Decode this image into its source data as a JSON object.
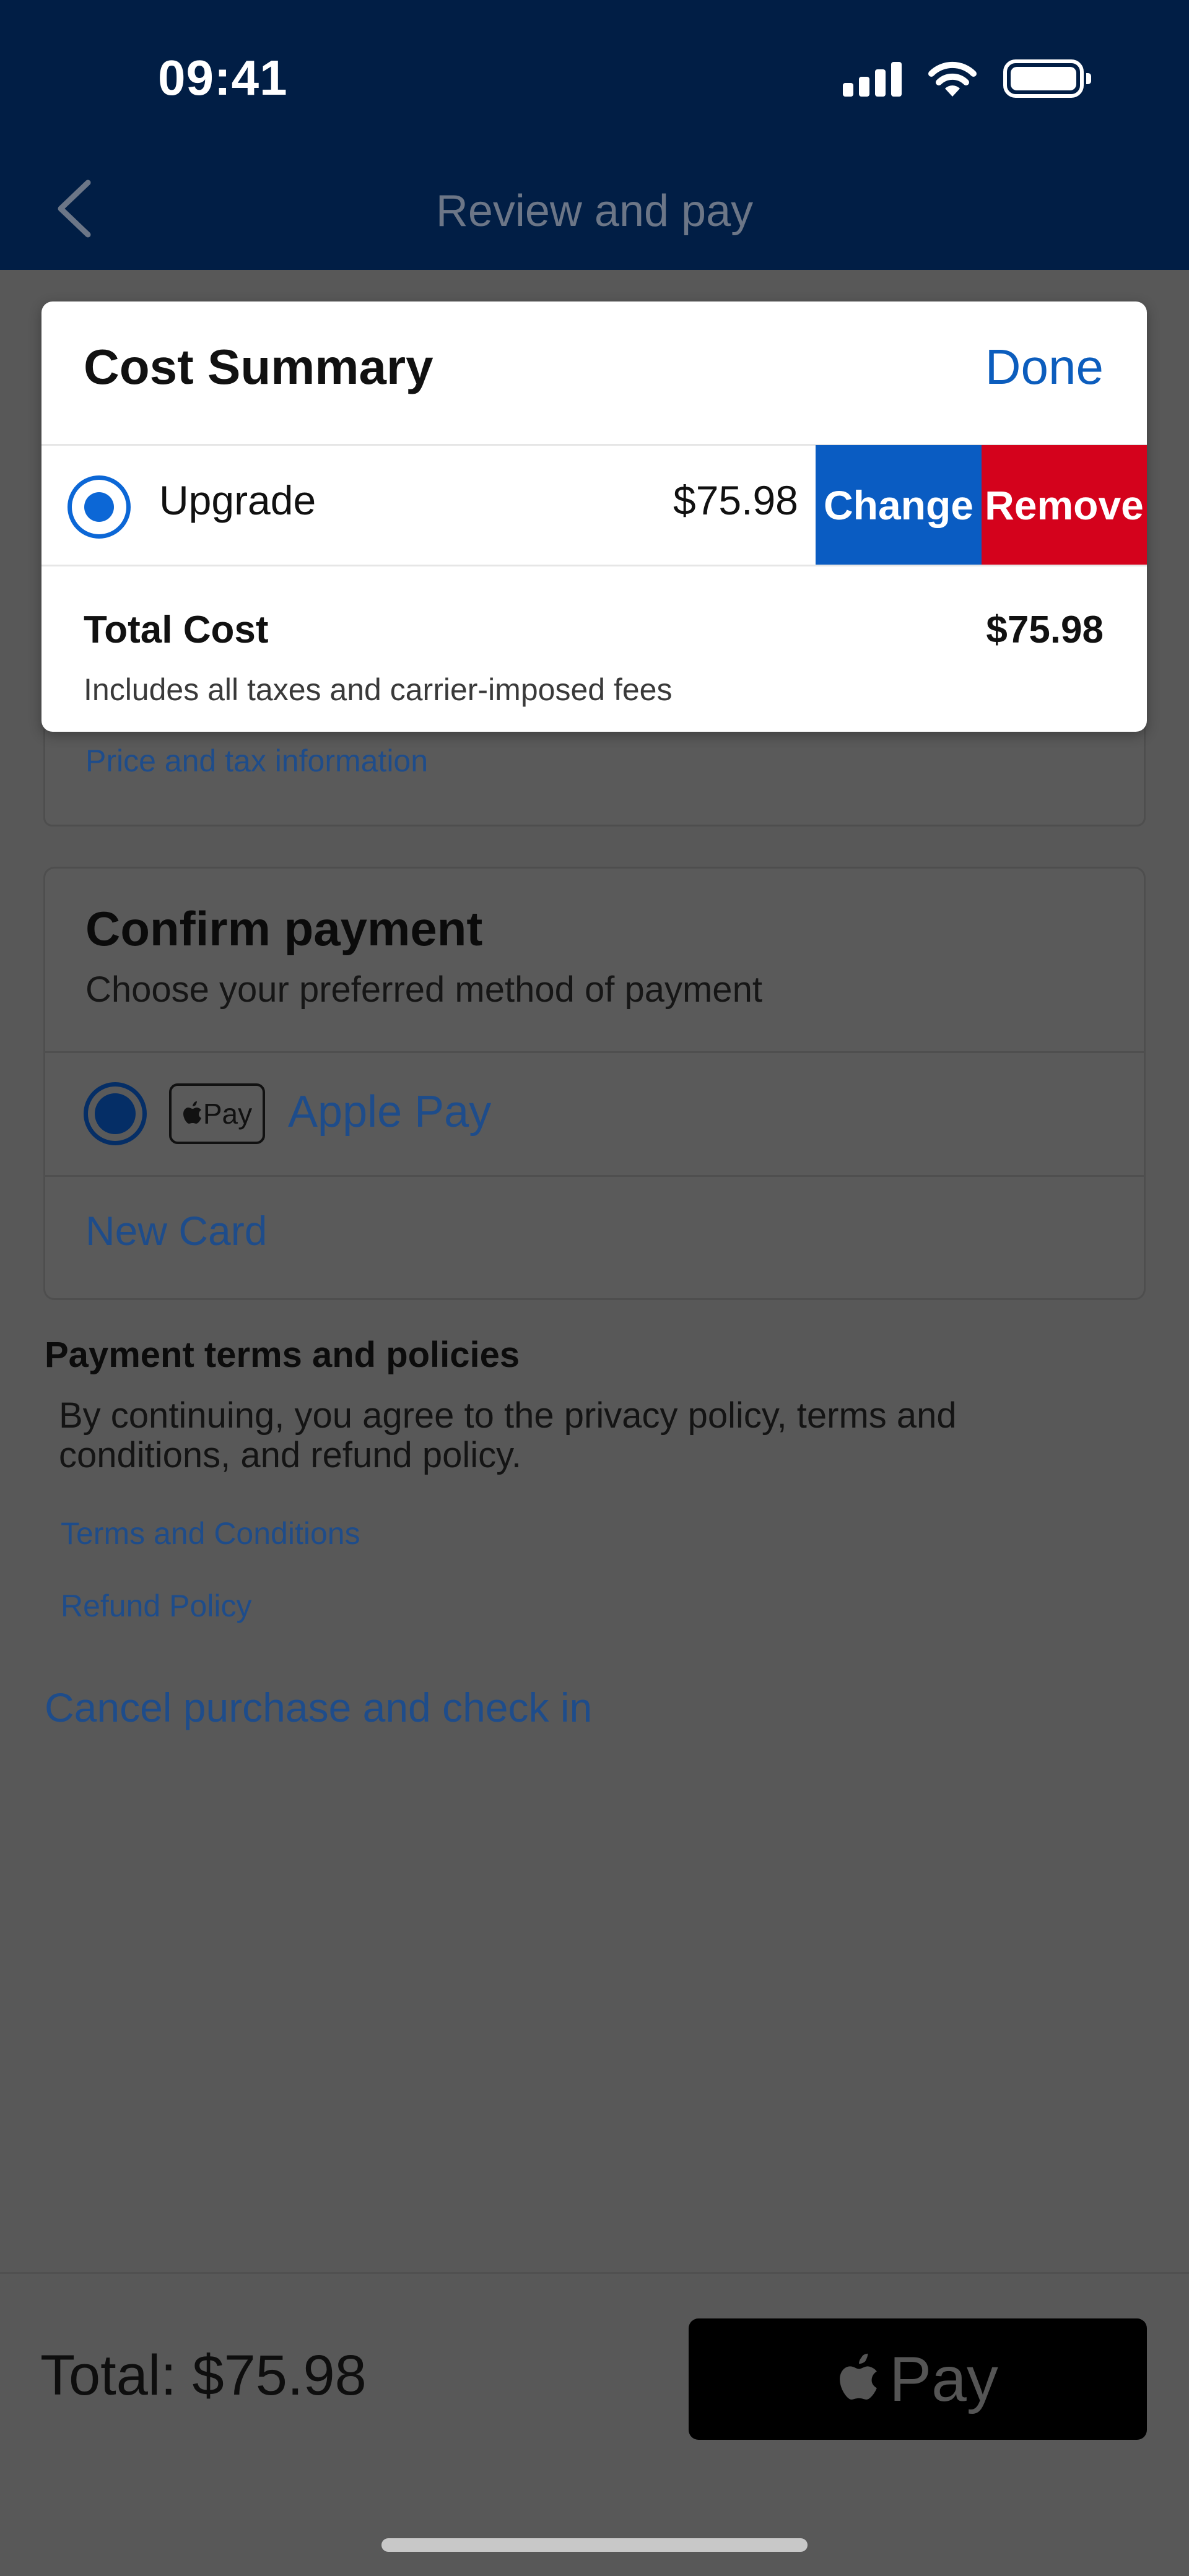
{
  "status_bar": {
    "time": "09:41"
  },
  "nav": {
    "title": "Review and pay"
  },
  "background": {
    "price_tax_link": "Price and tax information",
    "confirm_payment": {
      "title": "Confirm payment",
      "subtitle": "Choose your preferred method of payment",
      "apple_pay_badge": "Pay",
      "apple_pay_label": "Apple Pay",
      "new_card": "New Card"
    },
    "terms": {
      "title": "Payment terms and policies",
      "body": "By continuing, you agree to the privacy policy, terms and conditions, and refund policy.",
      "terms_link": "Terms and Conditions",
      "refund_link": "Refund Policy"
    },
    "cancel_link": "Cancel purchase and check in"
  },
  "bottom_bar": {
    "total": "Total: $75.98",
    "apple_pay_button": "Pay"
  },
  "modal": {
    "title": "Cost Summary",
    "done": "Done",
    "item": {
      "label": "Upgrade",
      "price": "$75.98",
      "selected": true
    },
    "change": "Change",
    "remove": "Remove",
    "total_label": "Total Cost",
    "total_value": "$75.98",
    "total_note": "Includes all taxes and carrier-imposed fees"
  },
  "colors": {
    "header": "#011e45",
    "link": "#0c5dbd",
    "change": "#0a5cc2",
    "remove": "#d4021c"
  }
}
